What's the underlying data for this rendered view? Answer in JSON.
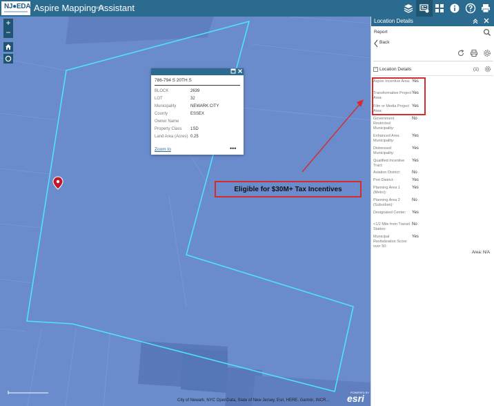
{
  "header": {
    "logo": "NJ●EDA",
    "title": "Aspire Mapping Assistant",
    "version": "v4.0",
    "icons": [
      "layers-icon",
      "legend-icon",
      "apps-grid-icon",
      "info-icon",
      "help-icon",
      "print-icon"
    ]
  },
  "map": {
    "controls": [
      "zoom-in",
      "zoom-out",
      "home",
      "locate"
    ],
    "zoom_in_label": "+",
    "zoom_out_label": "−",
    "attribution": "City of Newark, NYC OpenData, State of New Jersey, Esri, HERE, Garmin, INCR...",
    "esri_powered": "POWERED BY",
    "esri_word": "esri",
    "colors": {
      "water": "#6a8ccd",
      "outline": "#4de3ff",
      "marker": "#c0182a",
      "annotation": "#d62b2b"
    }
  },
  "popup": {
    "title": "786-794 S 20TH S",
    "fields": [
      {
        "label": "BLOCK",
        "value": "2639"
      },
      {
        "label": "LOT",
        "value": "32"
      },
      {
        "label": "Municipality",
        "value": "NEWARK CITY"
      },
      {
        "label": "County",
        "value": "ESSEX"
      },
      {
        "label": "Owner Name",
        "value": ""
      },
      {
        "label": "Property Class",
        "value": "1SD"
      },
      {
        "label": "Land Area (Acres)",
        "value": "0.25"
      }
    ],
    "zoom_to": "Zoom to",
    "more": "•••"
  },
  "callout": {
    "text": "Eligible for $30M+ Tax Incentives"
  },
  "panel": {
    "title": "Location Details",
    "report_label": "Report",
    "back_label": "Back",
    "section_label": "Location Details",
    "section_count": "(1)",
    "section_toggle": "−",
    "fields": [
      {
        "label": "Aspire Incentive Area:",
        "value": "Yes"
      },
      {
        "label": "Transformative Project Area:",
        "value": "Yes"
      },
      {
        "label": "Film or Media Project Area:",
        "value": "Yes"
      },
      {
        "label": "Government Restricted Municipality:",
        "value": "No"
      },
      {
        "label": "Enhanced Area Municipality:",
        "value": "Yes"
      },
      {
        "label": "Distressed Municipality:",
        "value": "Yes"
      },
      {
        "label": "Qualified Incentive Tract:",
        "value": "Yes"
      },
      {
        "label": "Aviation District:",
        "value": "No"
      },
      {
        "label": "Port District:",
        "value": "Yes"
      },
      {
        "label": "Planning Area 1 (Metro):",
        "value": "Yes"
      },
      {
        "label": "Planning Area 2 (Suburban):",
        "value": "No"
      },
      {
        "label": "Designated Center:",
        "value": "Yes"
      },
      {
        "label": "<1/2 Mile from Transit Station:",
        "value": "No"
      },
      {
        "label": "Municipal Revitalization Score over 50:",
        "value": "Yes"
      }
    ],
    "area_label": "Area: N/A"
  }
}
